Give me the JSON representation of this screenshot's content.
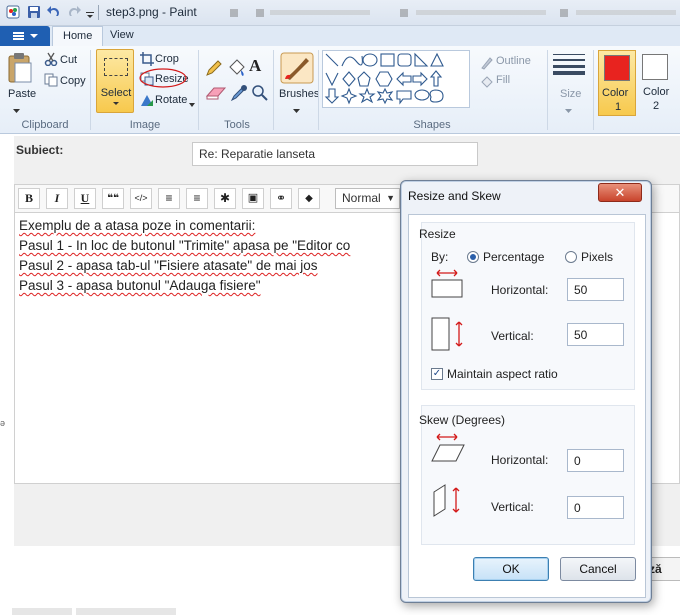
{
  "window": {
    "title": "step3.png - Paint"
  },
  "ribbon": {
    "tabs": [
      "Home",
      "View"
    ],
    "clipboard": {
      "paste": "Paste",
      "cut": "Cut",
      "copy": "Copy",
      "group": "Clipboard"
    },
    "image": {
      "select": "Select",
      "crop": "Crop",
      "resize": "Resize",
      "rotate": "Rotate",
      "group": "Image"
    },
    "tools": {
      "group": "Tools"
    },
    "brushes": "Brushes",
    "shapes": {
      "outline": "Outline",
      "fill": "Fill",
      "group": "Shapes"
    },
    "size": "Size",
    "color1": {
      "label": "Color",
      "num": "1",
      "value": "#e8231f"
    },
    "color2": {
      "label": "Color",
      "num": "2",
      "value": "#ffffff"
    }
  },
  "editor": {
    "subject_label": "Subiect:",
    "subject_value": "Re: Reparatie lanseta",
    "format_select": "Normal",
    "toolbar_glyphs": [
      "B",
      "I",
      "U",
      "❝❝",
      "</>",
      "≡",
      "≡",
      "✱",
      "▣",
      "⚭",
      "◆"
    ],
    "lines": [
      "Exemplu de a atasa poze in comentarii:",
      "Pasul 1 - In loc de butonul \"Trimite\" apasa pe \"Editor co",
      "Pasul 2 - apasa tab-ul \"Fisiere atasate\" de mai jos",
      "Pasul 3 - apasa butonul \"Adauga fisiere\""
    ],
    "bottom_button": "ză"
  },
  "dialog": {
    "title": "Resize and Skew",
    "close": "✕",
    "resize": {
      "title": "Resize",
      "by_label": "By:",
      "percentage_label": "Percentage",
      "pixels_label": "Pixels",
      "horizontal_label": "Horizontal:",
      "horizontal_value": "50",
      "vertical_label": "Vertical:",
      "vertical_value": "50",
      "maintain_label": "Maintain aspect ratio"
    },
    "skew": {
      "title": "Skew (Degrees)",
      "horizontal_label": "Horizontal:",
      "horizontal_value": "0",
      "vertical_label": "Vertical:",
      "vertical_value": "0"
    },
    "ok": "OK",
    "cancel": "Cancel"
  }
}
